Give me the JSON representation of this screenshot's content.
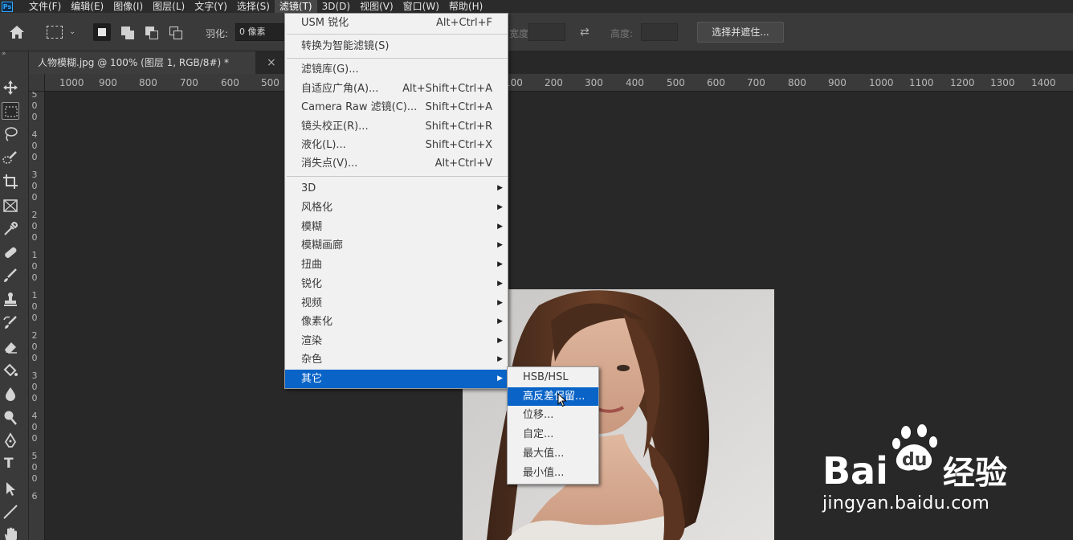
{
  "app": {
    "logo": "Ps"
  },
  "menubar": {
    "items": [
      "文件(F)",
      "编辑(E)",
      "图像(I)",
      "图层(L)",
      "文字(Y)",
      "选择(S)",
      "滤镜(T)",
      "3D(D)",
      "视图(V)",
      "窗口(W)",
      "帮助(H)"
    ],
    "active_index": 6
  },
  "options": {
    "marquee_dropdown": "⌄",
    "feather_label": "羽化:",
    "feather_value": "0 像素",
    "width_label": "宽度:",
    "height_label": "高度:",
    "swap_icon": "⇄",
    "select_mask": "选择并遮住..."
  },
  "document_tab": {
    "title": "人物模糊.jpg @ 100% (图层 1, RGB/8#) *",
    "close": "×"
  },
  "ruler": {
    "h_labels": [
      "1000",
      "900",
      "800",
      "700",
      "600",
      "500",
      "100",
      "200",
      "300",
      "400",
      "500",
      "600",
      "700",
      "800",
      "900",
      "1000",
      "1100",
      "1200",
      "1300",
      "1400"
    ],
    "v_labels": [
      "5",
      "0",
      "0",
      "4",
      "0",
      "0",
      "3",
      "0",
      "0",
      "2",
      "0",
      "0",
      "1",
      "0",
      "0",
      "1",
      "0",
      "0",
      "2",
      "0",
      "0",
      "3",
      "0",
      "0",
      "4",
      "0",
      "0",
      "5",
      "0",
      "0",
      "6"
    ]
  },
  "filter_menu": {
    "items": [
      {
        "label": "USM 锐化",
        "shortcut": "Alt+Ctrl+F"
      },
      {
        "label": "转换为智能滤镜(S)"
      },
      {
        "label": "滤镜库(G)..."
      },
      {
        "label": "自适应广角(A)...",
        "shortcut": "Alt+Shift+Ctrl+A"
      },
      {
        "label": "Camera Raw 滤镜(C)...",
        "shortcut": "Shift+Ctrl+A"
      },
      {
        "label": "镜头校正(R)...",
        "shortcut": "Shift+Ctrl+R"
      },
      {
        "label": "液化(L)...",
        "shortcut": "Shift+Ctrl+X"
      },
      {
        "label": "消失点(V)...",
        "shortcut": "Alt+Ctrl+V"
      },
      {
        "label": "3D"
      },
      {
        "label": "风格化"
      },
      {
        "label": "模糊"
      },
      {
        "label": "模糊画廊"
      },
      {
        "label": "扭曲"
      },
      {
        "label": "锐化"
      },
      {
        "label": "视频"
      },
      {
        "label": "像素化"
      },
      {
        "label": "渲染"
      },
      {
        "label": "杂色"
      },
      {
        "label": "其它"
      }
    ],
    "submenu_arrow": "▶",
    "highlighted": "其它"
  },
  "other_submenu": {
    "items": [
      "HSB/HSL",
      "高反差保留...",
      "位移...",
      "自定...",
      "最大值...",
      "最小值..."
    ],
    "highlighted": "高反差保留..."
  },
  "watermark": {
    "brand": "Bai",
    "brand_du": "du",
    "cn": "经验",
    "url": "jingyan.baidu.com"
  },
  "colors": {
    "accent": "#0a64c8",
    "ui_dark": "#282828",
    "panel": "#3a3a3a",
    "menu_bg": "#f1f1f1"
  }
}
